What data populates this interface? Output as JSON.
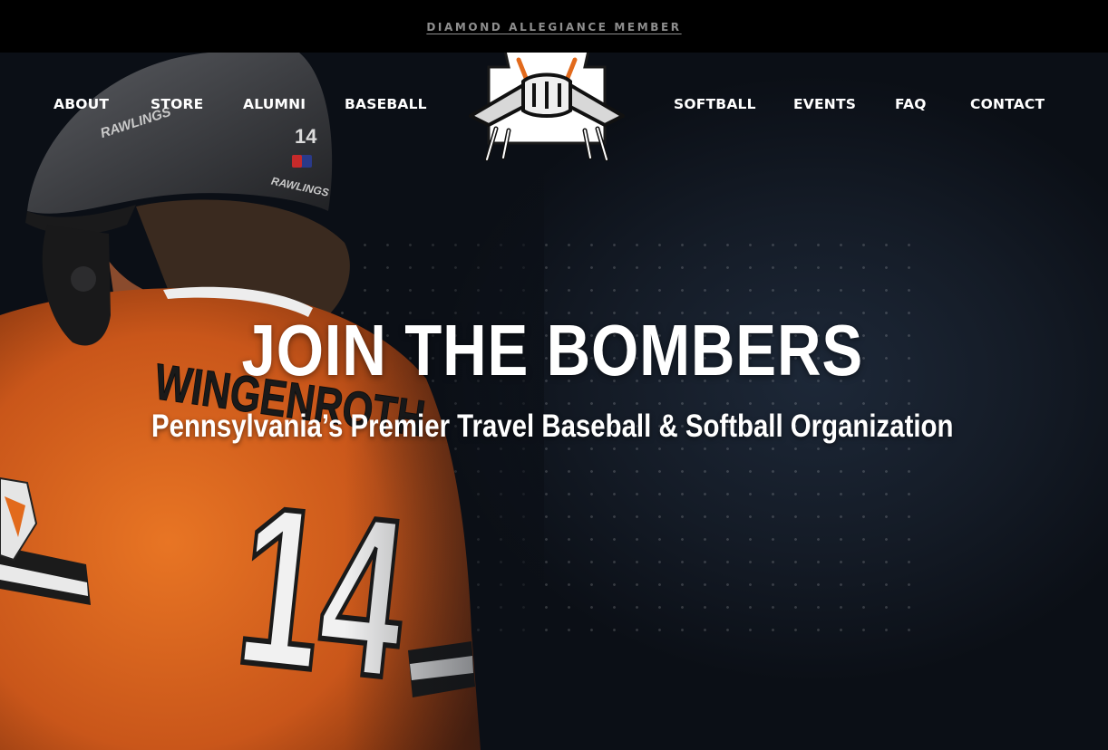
{
  "topbar": {
    "link_text": "DIAMOND ALLEGIANCE MEMBER"
  },
  "nav": {
    "left": [
      {
        "label": "ABOUT"
      },
      {
        "label": "STORE"
      },
      {
        "label": "ALUMNI"
      },
      {
        "label": "BASEBALL"
      }
    ],
    "right": [
      {
        "label": "SOFTBALL"
      },
      {
        "label": "EVENTS"
      },
      {
        "label": "FAQ"
      },
      {
        "label": "CONTACT"
      }
    ],
    "logo_icon": "bombers-logo"
  },
  "hero": {
    "title": "JOIN THE BOMBERS",
    "subtitle": "Pennsylvania’s Premier Travel Baseball & Softball Organization",
    "jersey_name": "WINGENROTH",
    "jersey_number": "14",
    "helmet_number": "14",
    "helmet_brand": "RAWLINGS",
    "background_image": "baseball-player-photo"
  },
  "colors": {
    "jersey_orange": "#e26a1c",
    "background": "#0b0f16",
    "topbar_link": "#8e8e8e"
  }
}
